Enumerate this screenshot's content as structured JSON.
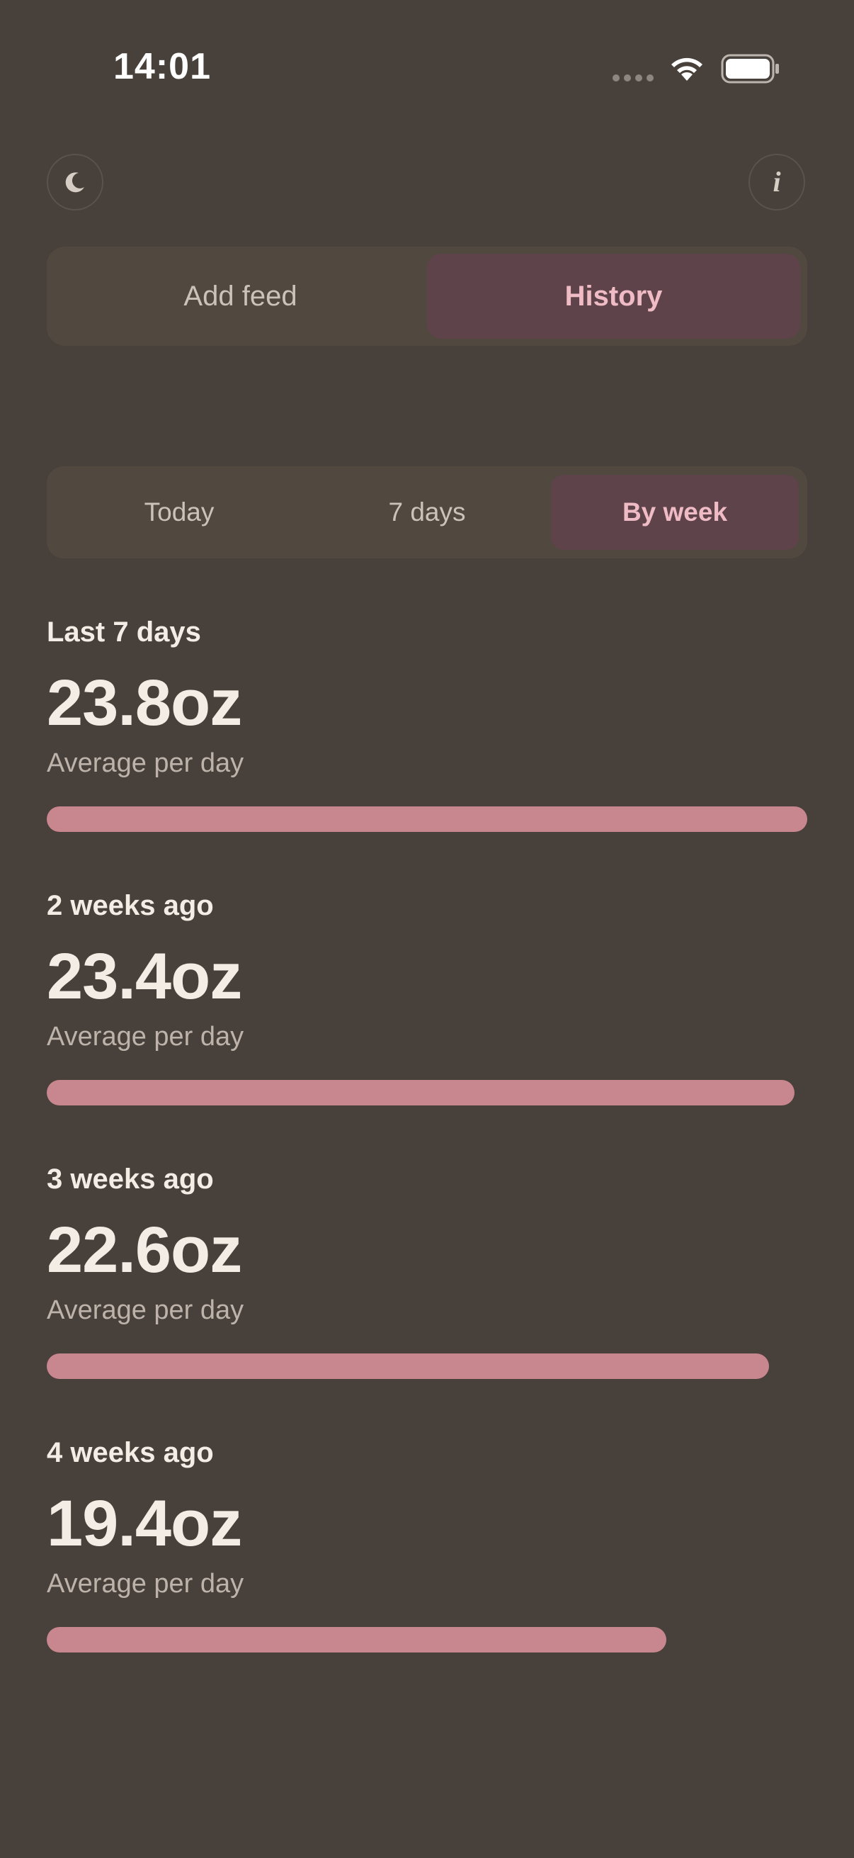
{
  "status_bar": {
    "time": "14:01"
  },
  "header": {
    "theme_icon": "moon-icon",
    "info_icon": "info-icon",
    "info_glyph": "i"
  },
  "main_tabs": [
    {
      "label": "Add feed",
      "active": false
    },
    {
      "label": "History",
      "active": true
    }
  ],
  "range_tabs": [
    {
      "label": "Today",
      "active": false
    },
    {
      "label": "7 days",
      "active": false
    },
    {
      "label": "By week",
      "active": true
    }
  ],
  "weeks": [
    {
      "label": "Last 7 days",
      "value": "23.8oz",
      "sub": "Average per day",
      "amount": 23.8
    },
    {
      "label": "2 weeks ago",
      "value": "23.4oz",
      "sub": "Average per day",
      "amount": 23.4
    },
    {
      "label": "3 weeks ago",
      "value": "22.6oz",
      "sub": "Average per day",
      "amount": 22.6
    },
    {
      "label": "4 weeks ago",
      "value": "19.4oz",
      "sub": "Average per day",
      "amount": 19.4
    }
  ],
  "colors": {
    "background": "#48403a",
    "accent": "#c8868f",
    "active_tab": "#5f434a",
    "active_text": "#efbcc6"
  }
}
